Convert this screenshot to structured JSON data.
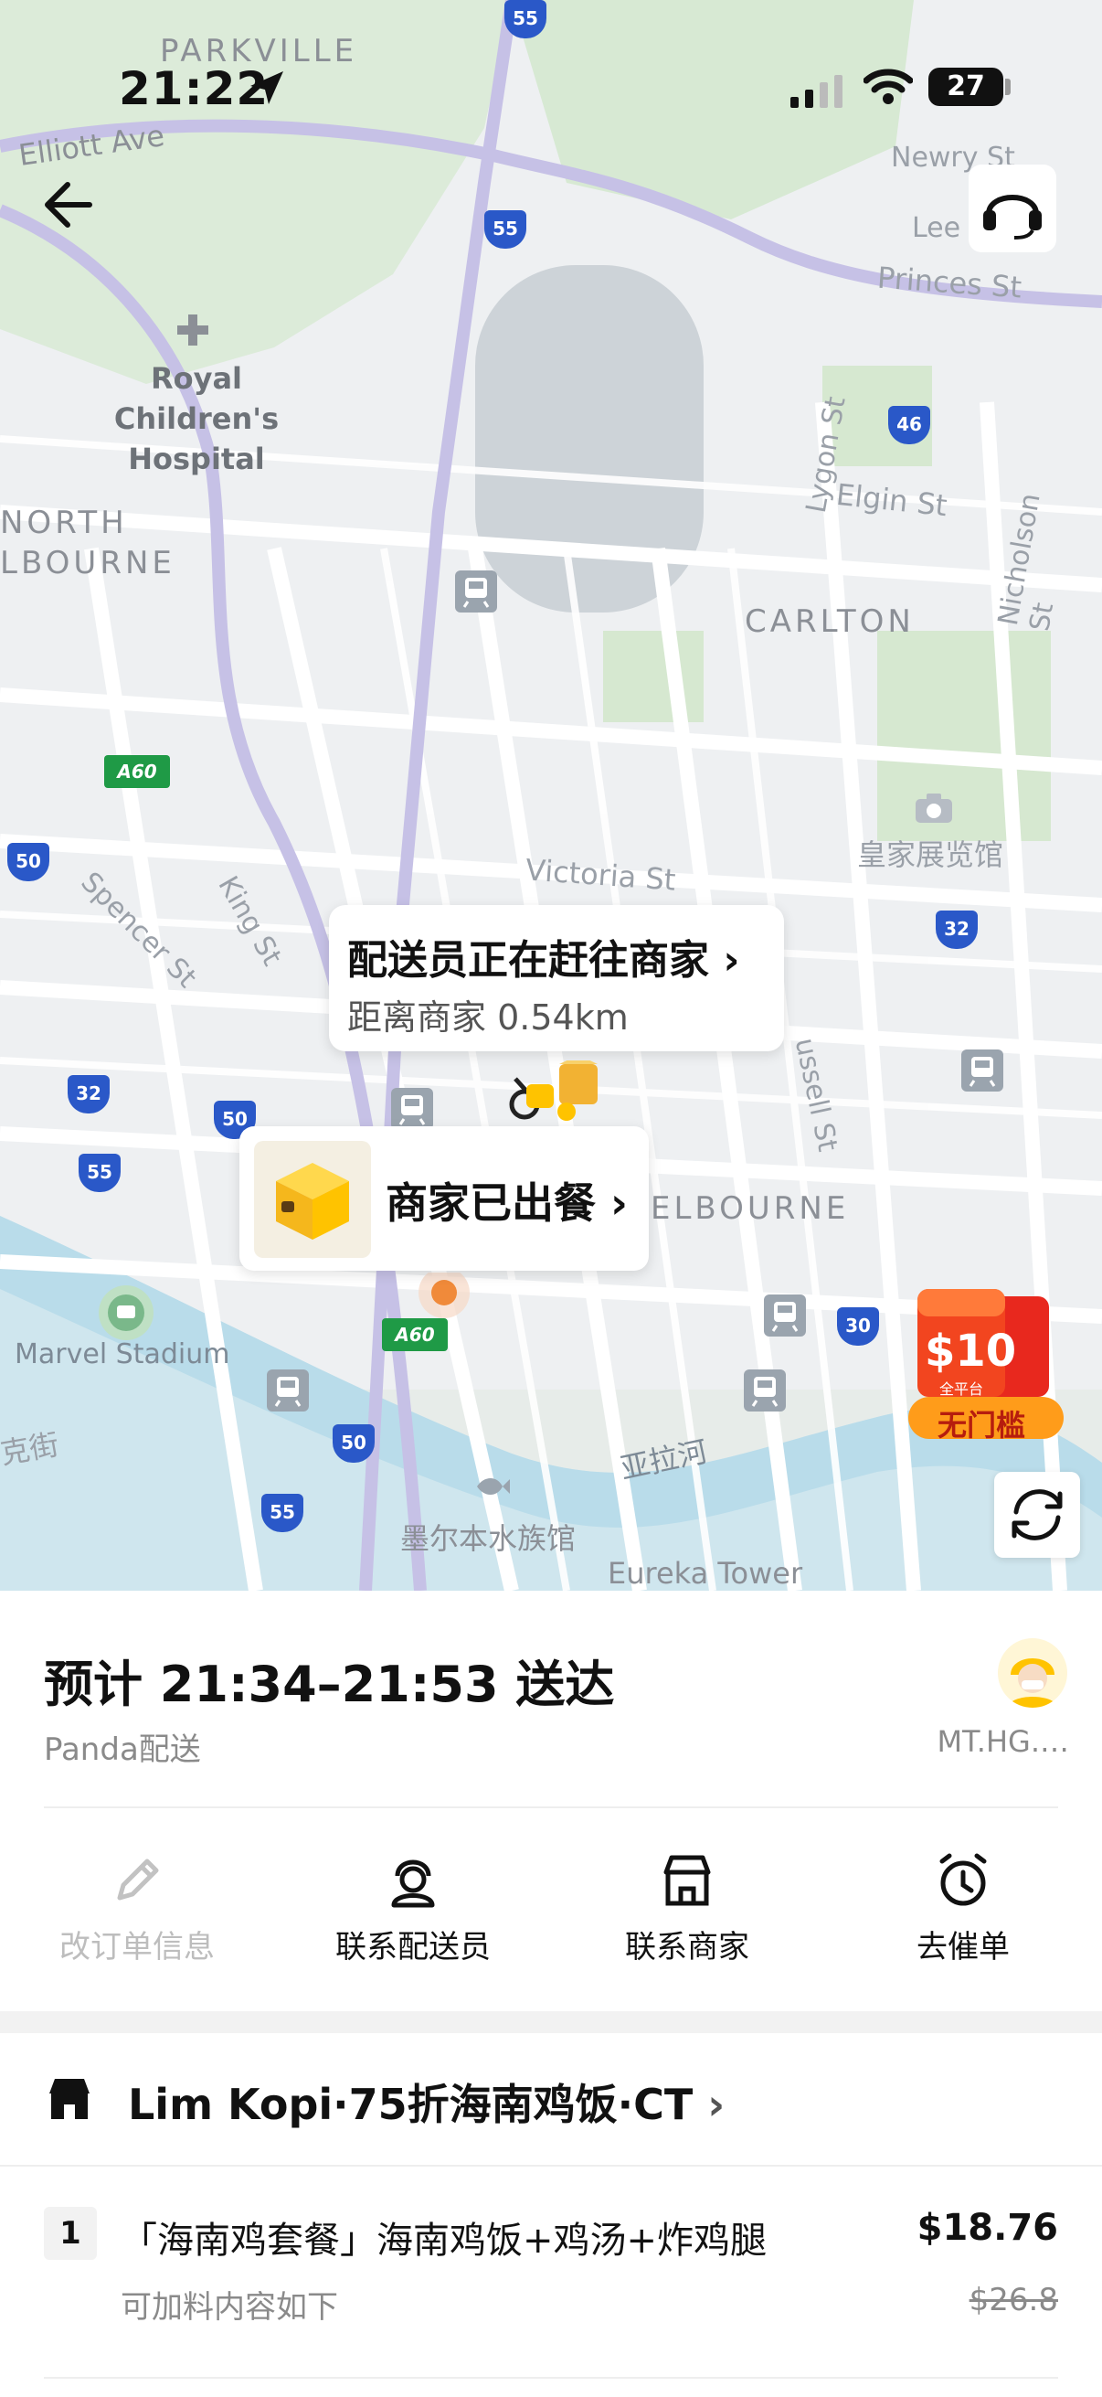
{
  "status_bar": {
    "time": "21:22",
    "battery": "27"
  },
  "map": {
    "labels": {
      "parkville": "PARKVILLE",
      "elliott_ave": "Elliott Ave",
      "newry_st": "Newry St",
      "lee_st": "Lee",
      "princes_st": "Princes St",
      "hospital": "Royal Children's Hospital",
      "north_melbourne_1": "NORTH",
      "north_melbourne_2": "LBOURNE",
      "lygon_st": "Lygon St",
      "elgin_st": "Elgin St",
      "nicholson_st": "Nicholson St",
      "carlton": "CARLTON",
      "exhibition": "皇家展览馆",
      "victoria_st": "Victoria St",
      "spencer_st": "Spencer St",
      "king_st": "King St",
      "russell_st": "ussell St",
      "melbourne": "ELBOURNE",
      "marvel": "Marvel Stadium",
      "yarra": "亚拉河",
      "aquarium": "墨尔本水族馆",
      "eureka": "Eureka Tower",
      "ke_jie": "克街",
      "route_55": "55",
      "route_46": "46",
      "route_50": "50",
      "route_32": "32",
      "route_30": "30",
      "route_a60": "A60"
    },
    "rider_status": "配送员正在赶往商家",
    "rider_distance": "距离商家 0.54km",
    "merchant_status": "商家已出餐",
    "coupon_amount": "10",
    "coupon_scope": "全平台",
    "coupon_label": "无门槛"
  },
  "delivery": {
    "eta_text": "预计 21:34–21:53 送达",
    "carrier": "Panda配送",
    "rider_name": "MT.HG.…"
  },
  "actions": [
    {
      "label": "改订单信息",
      "icon": "edit-icon",
      "enabled": false
    },
    {
      "label": "联系配送员",
      "icon": "rider-icon",
      "enabled": true
    },
    {
      "label": "联系商家",
      "icon": "store-icon",
      "enabled": true
    },
    {
      "label": "去催单",
      "icon": "alarm-icon",
      "enabled": true
    }
  ],
  "store": {
    "name": "Lim Kopi·75折海南鸡饭·CT"
  },
  "items": [
    {
      "qty": "1",
      "name": "「海南鸡套餐」海南鸡饭+鸡汤+炸鸡腿",
      "price": "$18.76",
      "addon_note": "可加料内容如下",
      "original_price": "$26.8"
    }
  ],
  "colors": {
    "accent": "#ffc300",
    "coupon_red": "#e8281e",
    "tram_blue": "#2a58c8",
    "route_green": "#1f9a46"
  }
}
